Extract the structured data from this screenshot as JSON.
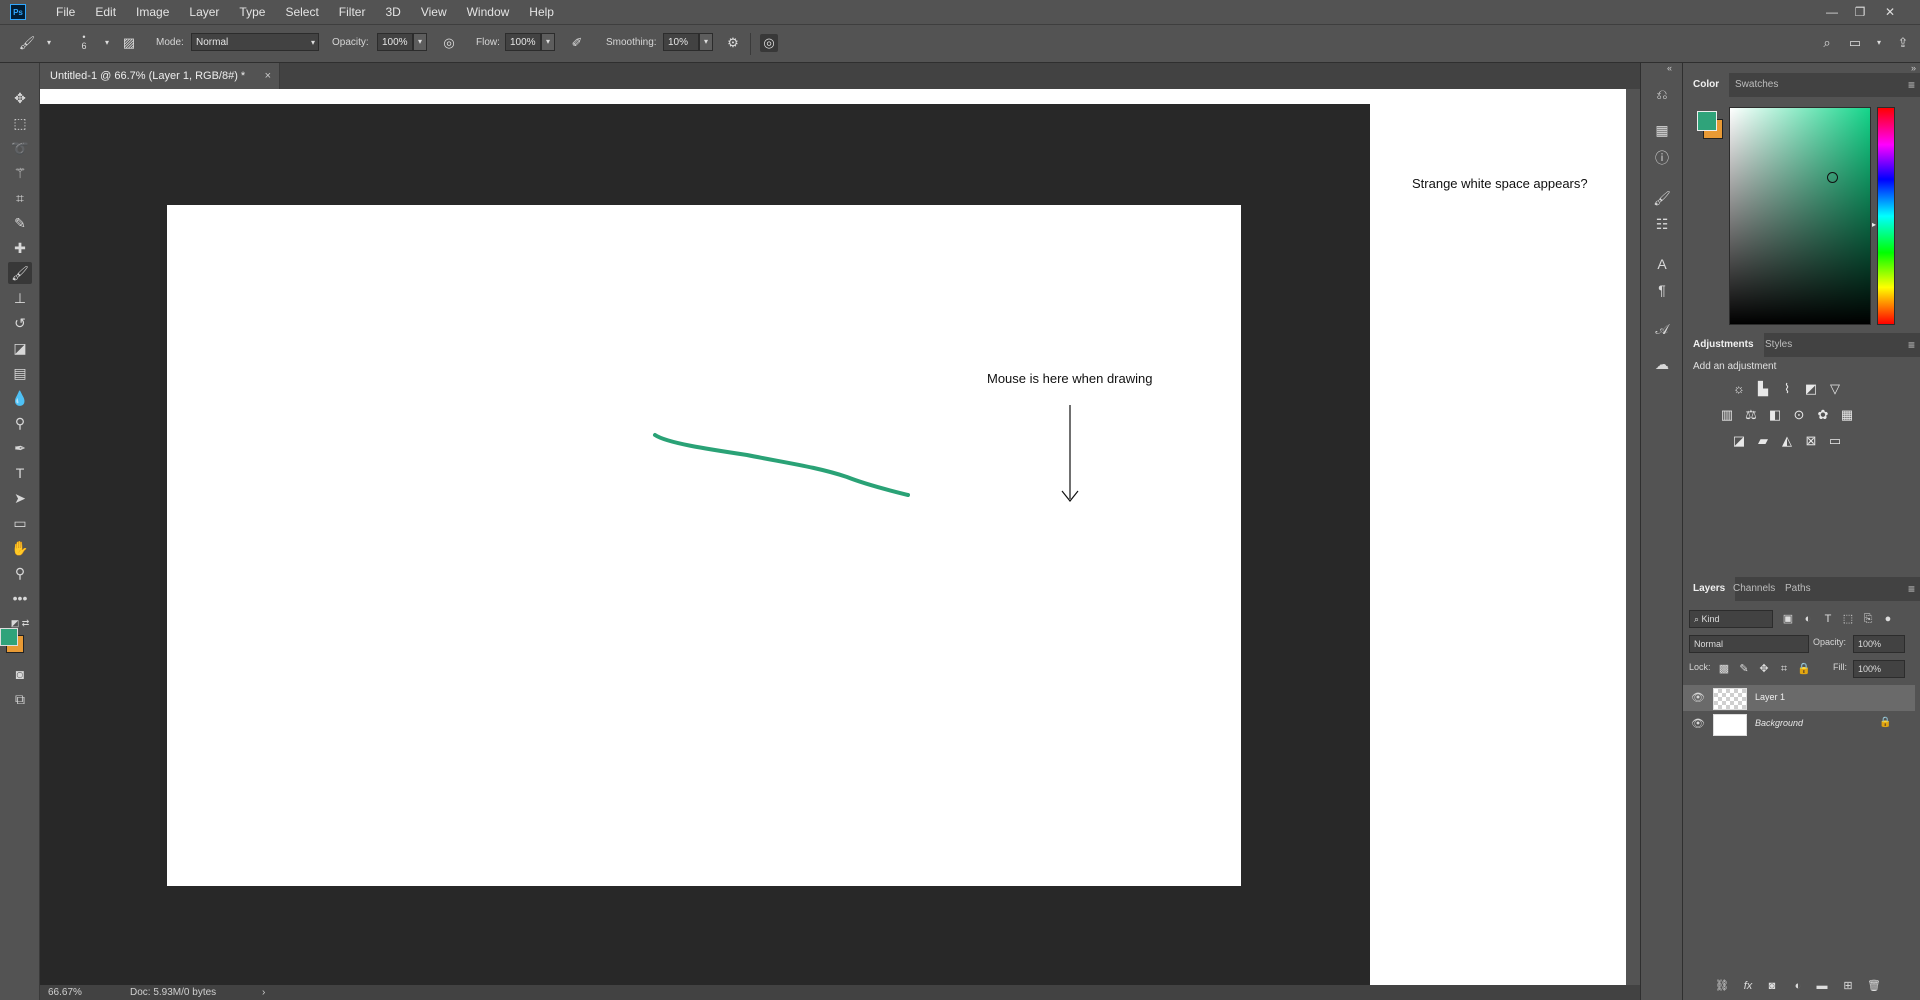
{
  "app": {
    "logo": "Ps"
  },
  "menu": [
    "File",
    "Edit",
    "Image",
    "Layer",
    "Type",
    "Select",
    "Filter",
    "3D",
    "View",
    "Window",
    "Help"
  ],
  "options": {
    "brush_size": "6",
    "mode_label": "Mode:",
    "mode_value": "Normal",
    "opacity_label": "Opacity:",
    "opacity_value": "100%",
    "flow_label": "Flow:",
    "flow_value": "100%",
    "smoothing_label": "Smoothing:",
    "smoothing_value": "10%"
  },
  "document": {
    "tab_title": "Untitled-1 @ 66.7% (Layer 1, RGB/8#) *",
    "close": "×",
    "zoom": "66.67%",
    "doc_info": "Doc: 5.93M/0 bytes",
    "status_arrow": "›"
  },
  "annotations": {
    "white_space": "Strange white space appears?",
    "mouse": "Mouse is here when drawing"
  },
  "colors": {
    "foreground": "#2fa37a",
    "background": "#e89a35",
    "stroke": "#2aa276"
  },
  "color_panel": {
    "tabs": [
      "Color",
      "Swatches"
    ]
  },
  "adjustments_panel": {
    "tabs": [
      "Adjustments",
      "Styles"
    ],
    "subtitle": "Add an adjustment"
  },
  "layers_panel": {
    "tabs": [
      "Layers",
      "Channels",
      "Paths"
    ],
    "kind_label": "Kind",
    "blend_mode": "Normal",
    "opacity_label": "Opacity:",
    "opacity_value": "100%",
    "lock_label": "Lock:",
    "fill_label": "Fill:",
    "fill_value": "100%",
    "layers": [
      {
        "name": "Layer 1"
      },
      {
        "name": "Background"
      }
    ]
  }
}
